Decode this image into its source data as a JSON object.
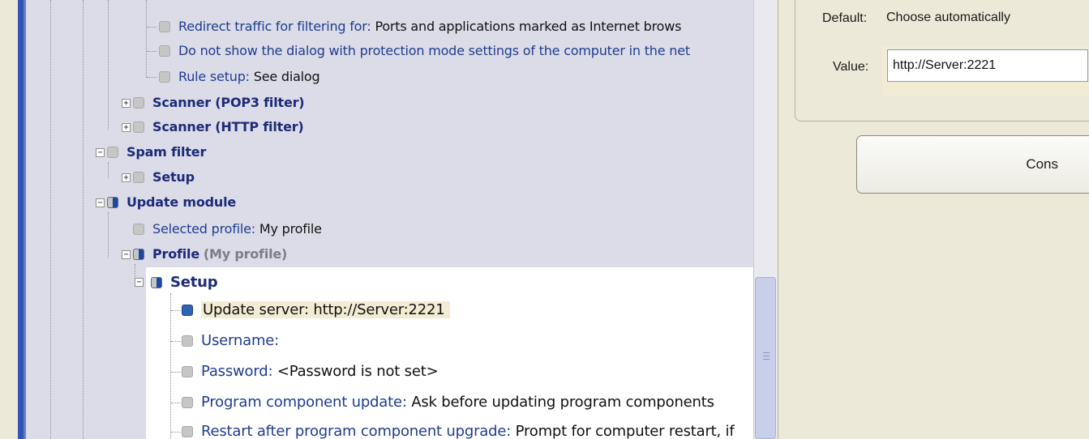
{
  "tree": {
    "partial_top_row": "",
    "rows": [
      {
        "label": "Redirect traffic for filtering for: ",
        "value": "Ports and applications marked as Internet brows"
      },
      {
        "label": "Do not show the dialog with protection mode settings of the computer in the net",
        "value": ""
      },
      {
        "label": "Rule setup: ",
        "value": "See dialog"
      },
      {
        "label": "Scanner (POP3 filter)",
        "value": ""
      },
      {
        "label": "Scanner (HTTP filter)",
        "value": ""
      },
      {
        "label": "Spam filter",
        "value": ""
      },
      {
        "label": "Setup",
        "value": ""
      },
      {
        "label": "Update module",
        "value": ""
      },
      {
        "label": "Selected profile: ",
        "value": "My profile"
      },
      {
        "label": "Profile",
        "value": "(My profile)"
      },
      {
        "label": "Setup",
        "value": ""
      },
      {
        "label": "Update server: http://Server:2221",
        "value": ""
      },
      {
        "label": "Username:",
        "value": ""
      },
      {
        "label": "Password: ",
        "value": "<Password is not set>"
      },
      {
        "label": "Program component update: ",
        "value": "Ask before updating program components"
      },
      {
        "label": "Restart after program component upgrade: ",
        "value": "Prompt for computer restart, if"
      }
    ]
  },
  "props": {
    "default_label": "Default:",
    "default_value": "Choose automatically",
    "value_label": "Value:",
    "value_input": "http://Server:2221",
    "button_label": "Cons"
  }
}
